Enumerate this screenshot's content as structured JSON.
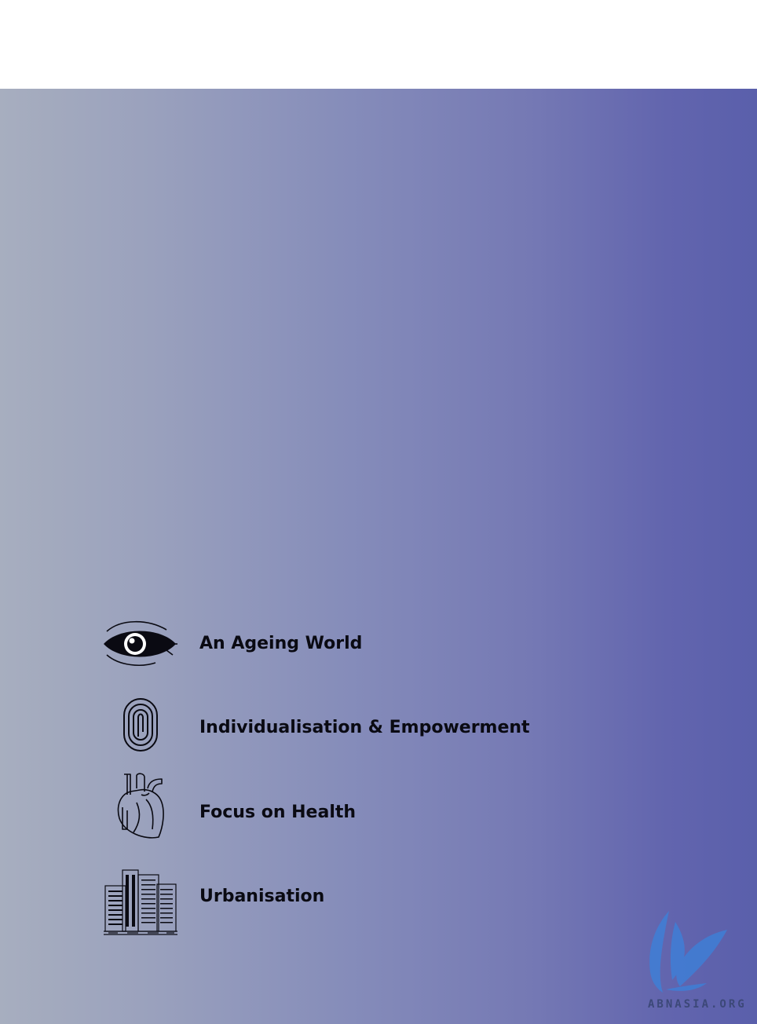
{
  "items": [
    {
      "label": "An Ageing World",
      "icon": "eye-icon"
    },
    {
      "label": "Individualisation & Empowerment",
      "icon": "fingerprint-icon"
    },
    {
      "label": "Focus on Health",
      "icon": "heart-icon"
    },
    {
      "label": "Urbanisation",
      "icon": "city-buildings-icon"
    }
  ],
  "watermark": {
    "text": "ABNASIA.ORG",
    "icon": "feather-logo-icon"
  },
  "colors": {
    "gradient_start": "#a7aebf",
    "gradient_end": "#5a5fab",
    "text": "#0a0a12",
    "logo": "#3f7fd6"
  }
}
